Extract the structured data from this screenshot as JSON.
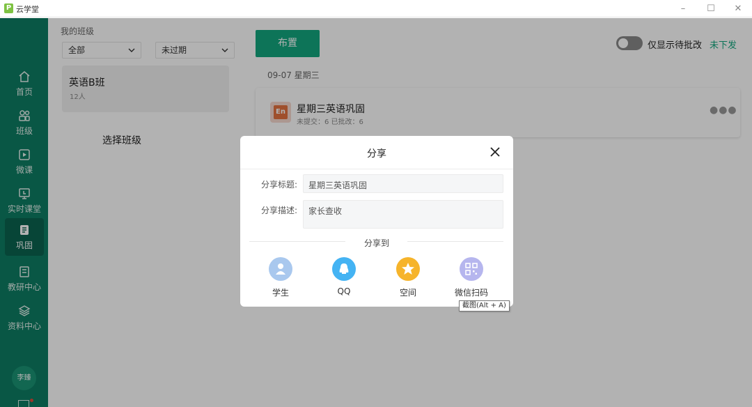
{
  "app": {
    "title": "云学堂",
    "logo_text": "P"
  },
  "window_controls": {
    "minimize": "–",
    "maximize": "☐",
    "close": "✕"
  },
  "sidebar": {
    "items": [
      {
        "label": "首页",
        "icon": "home-icon"
      },
      {
        "label": "班级",
        "icon": "class-icon"
      },
      {
        "label": "微课",
        "icon": "micro-lesson-icon"
      },
      {
        "label": "实时课堂",
        "icon": "live-class-icon"
      },
      {
        "label": "巩固",
        "icon": "consolidate-icon",
        "active": true
      },
      {
        "label": "教研中心",
        "icon": "research-icon"
      },
      {
        "label": "资料中心",
        "icon": "resources-icon"
      }
    ],
    "avatar_text": "李臻"
  },
  "class_panel": {
    "title": "我的班级",
    "filter_scope": "全部",
    "filter_status": "未过期",
    "class_card": {
      "name": "英语B班",
      "count": "12人"
    },
    "choose_class": "选择班级"
  },
  "main": {
    "assign_button": "布置",
    "toggle_label": "仅显示待批改",
    "not_sent_link": "未下发",
    "date": "09-07 星期三",
    "task": {
      "icon_text": "En",
      "title": "星期三英语巩固",
      "meta": "未提交：6   已批改：6"
    }
  },
  "dialog": {
    "title": "分享",
    "title_label": "分享标题:",
    "title_value": "星期三英语巩固",
    "desc_label": "分享描述:",
    "desc_value": "家长查收",
    "share_to": "分享到",
    "options": [
      {
        "label": "学生",
        "color": "#a9c8ee"
      },
      {
        "label": "QQ",
        "color": "#44b3f3"
      },
      {
        "label": "空间",
        "color": "#f6b42b"
      },
      {
        "label": "微信扫码",
        "color": "#b6b6ee"
      }
    ]
  },
  "tooltip": "截图(Alt + A)",
  "colors": {
    "sidebar": "#0e7d63",
    "accent": "#14a77f",
    "active_nav": "#0b6450"
  }
}
